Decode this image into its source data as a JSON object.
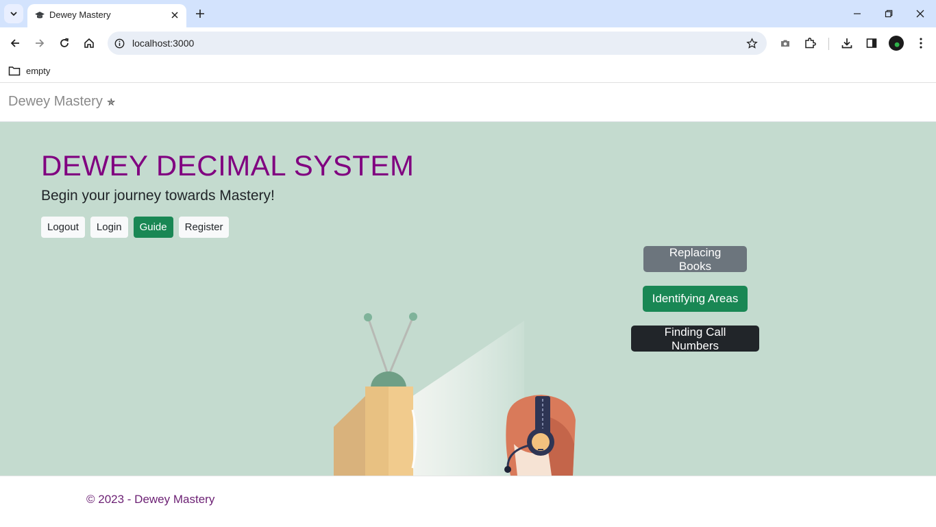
{
  "browser": {
    "tab_title": "Dewey Mastery",
    "url": "localhost:3000",
    "bookmarks": [
      {
        "label": "empty"
      }
    ]
  },
  "navbar": {
    "brand": "Dewey Mastery",
    "brand_icon": "star-icon"
  },
  "hero": {
    "title": "DEWEY DECIMAL SYSTEM",
    "subtitle": "Begin your journey towards Mastery!",
    "auth_buttons": [
      {
        "label": "Logout",
        "style": "light"
      },
      {
        "label": "Login",
        "style": "light"
      },
      {
        "label": "Guide",
        "style": "success"
      },
      {
        "label": "Register",
        "style": "light"
      }
    ],
    "game_buttons": [
      {
        "label": "Replacing Books",
        "color": "#6c757d"
      },
      {
        "label": "Identifying Areas",
        "color": "#198754"
      },
      {
        "label": "Finding Call Numbers",
        "color": "#212529"
      }
    ],
    "background_color": "#c4dbcf",
    "title_color": "#800080"
  },
  "footer": {
    "copyright": "© 2023 - Dewey Mastery"
  }
}
